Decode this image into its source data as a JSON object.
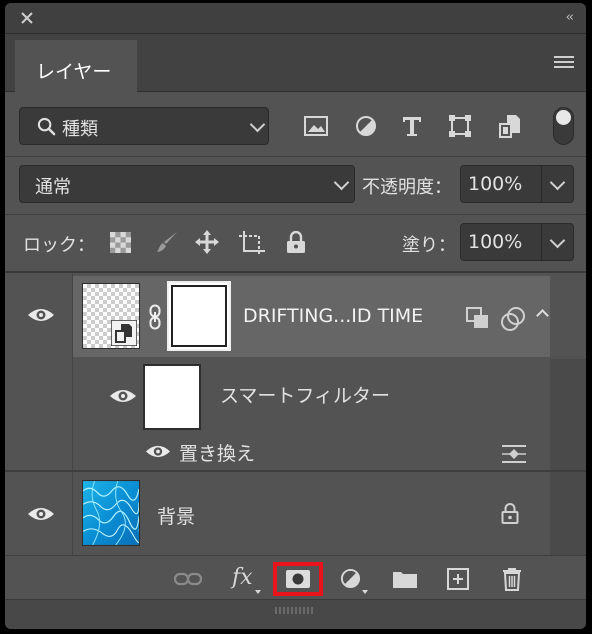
{
  "window": {
    "close_icon": "close-icon",
    "collapse_label": "‹‹"
  },
  "tabs": [
    {
      "label": "レイヤー",
      "active": true
    }
  ],
  "filter": {
    "kind_label": "種類",
    "icons": [
      "image-filter-icon",
      "adjustment-filter-icon",
      "type-filter-icon",
      "shape-filter-icon",
      "smart-object-filter-icon"
    ],
    "toggle_on": true
  },
  "blend": {
    "mode": "通常",
    "opacity_label": "不透明度：",
    "opacity_value": "100%"
  },
  "lock": {
    "label": "ロック：",
    "fill_label": "塗り：",
    "fill_value": "100%"
  },
  "layers": [
    {
      "name": "DRIFTING...ID TIME",
      "type": "smart-object",
      "selected": true,
      "visible": true
    },
    {
      "name": "スマートフィルター",
      "type": "smart-filter-group",
      "visible": true
    },
    {
      "name": "置き換え",
      "type": "smart-filter",
      "visible": true
    },
    {
      "name": "背景",
      "type": "background",
      "visible": true,
      "locked": true
    }
  ],
  "bottom_toolbar": {
    "fx_label": "fx",
    "highlighted": "add-mask-button",
    "highlight_color": "#e8131b"
  },
  "colors": {
    "panel": "#535353",
    "selected_row": "#656565",
    "dark_field": "#3a3a3a"
  }
}
